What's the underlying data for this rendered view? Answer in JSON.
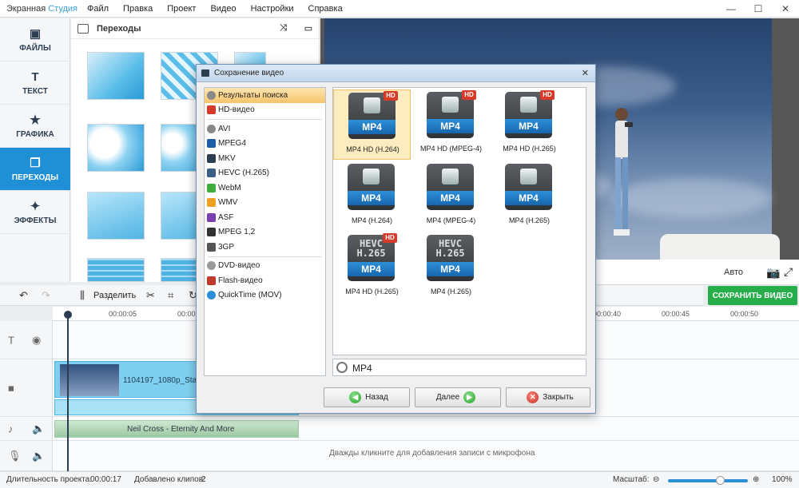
{
  "app": {
    "title_part1": "Экранная ",
    "title_part2": "Студия",
    "menu": [
      "Файл",
      "Правка",
      "Проект",
      "Видео",
      "Настройки",
      "Справка"
    ]
  },
  "leftnav": {
    "items": [
      {
        "label": "ФАЙЛЫ",
        "icon": "image-icon"
      },
      {
        "label": "ТЕКСТ",
        "icon": "text-icon"
      },
      {
        "label": "ГРАФИКА",
        "icon": "star-icon"
      },
      {
        "label": "ПЕРЕХОДЫ",
        "icon": "transitions-icon"
      },
      {
        "label": "ЭФФЕКТЫ",
        "icon": "magic-wand-icon"
      }
    ],
    "active_index": 3
  },
  "transitions_panel": {
    "title": "Переходы"
  },
  "preview": {
    "auto_label": "Авто"
  },
  "save_video_button": "СОХРАНИТЬ ВИДЕО",
  "toolbar": {
    "split_label": "Разделить"
  },
  "timeline": {
    "ticks": [
      "00:00:05",
      "00:00:10",
      "00:00:40",
      "00:00:45",
      "00:00:50"
    ],
    "video_clip_label": "1104197_1080p_Stand",
    "audio_clip_label": "Neil Cross - Eternity And More",
    "mic_hint": "Дважды кликните для добавления записи с микрофона"
  },
  "statusbar": {
    "duration_label": "Длительность проекта:",
    "duration_value": "00:00:17",
    "clips_label": "Добавлено клипов:",
    "clips_value": "2",
    "scale_label": "Масштаб:",
    "zoom_value": "100%"
  },
  "dialog": {
    "title": "Сохранение видео",
    "categories": [
      "Результаты поиска",
      "HD-видео",
      "AVI",
      "MPEG4",
      "MKV",
      "HEVC (H.265)",
      "WebM",
      "WMV",
      "ASF",
      "MPEG 1,2",
      "3GP",
      "DVD-видео",
      "Flash-видео",
      "QuickTime (MOV)"
    ],
    "selected_category": 0,
    "formats": [
      {
        "badge": "MP4",
        "label": "MP4 HD (H.264)",
        "hd": true
      },
      {
        "badge": "MP4",
        "label": "MP4 HD (MPEG-4)",
        "hd": true
      },
      {
        "badge": "MP4",
        "label": "MP4 HD (H.265)",
        "hd": true
      },
      {
        "badge": "MP4",
        "label": "MP4 (H.264)",
        "hd": false
      },
      {
        "badge": "MP4",
        "label": "MP4 (MPEG-4)",
        "hd": false
      },
      {
        "badge": "MP4",
        "label": "MP4 (H.265)",
        "hd": false
      },
      {
        "badge": "MP4",
        "label": "MP4 HD (H.265)",
        "hd": true,
        "hevc": "HEVC H.265"
      },
      {
        "badge": "MP4",
        "label": "MP4 (H.265)",
        "hd": false,
        "hevc": "HEVC H.265"
      }
    ],
    "hd_badge": "HD",
    "hevc_line1": "HEVC",
    "hevc_line2": "H.265",
    "selected_format": 0,
    "search_value": "MP4",
    "buttons": {
      "back": "Назад",
      "next": "Далее",
      "close": "Закрыть"
    }
  }
}
